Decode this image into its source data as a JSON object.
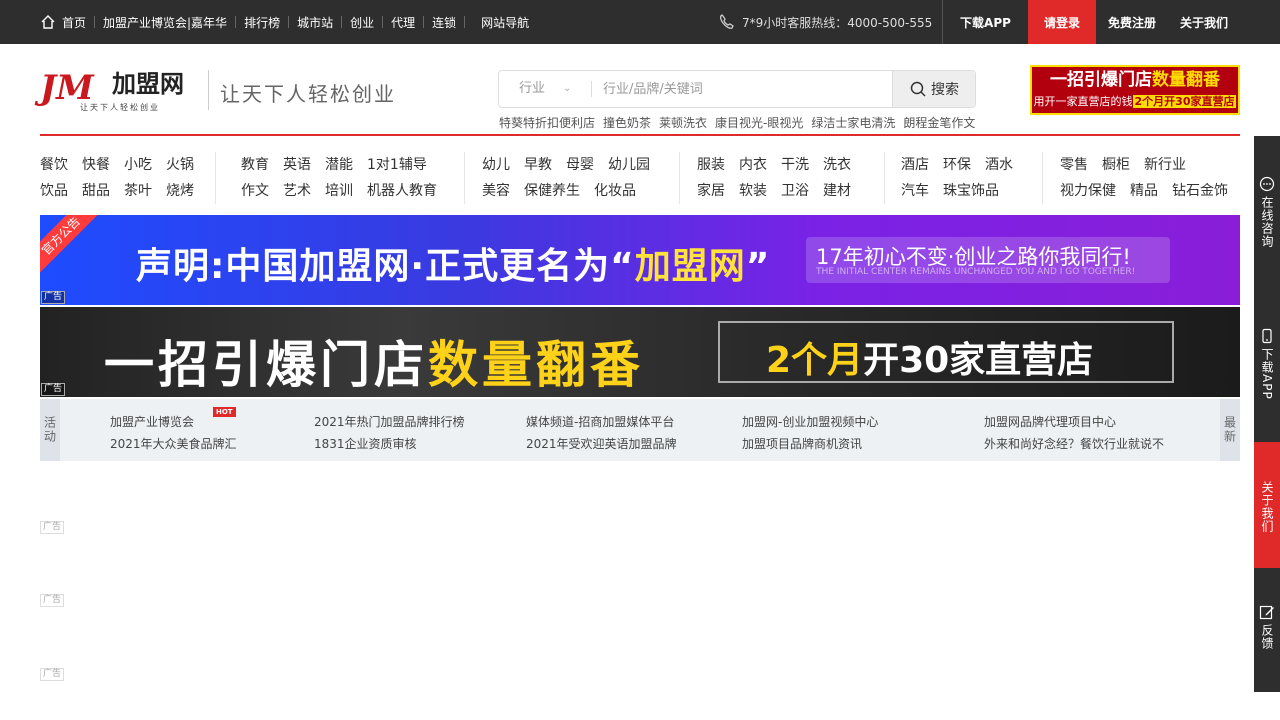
{
  "topbar": {
    "nav": [
      "首页",
      "加盟产业博览会|嘉年华",
      "排行榜",
      "城市站",
      "创业",
      "代理",
      "连锁",
      "网站导航"
    ],
    "hotline": "7*9小时客服热线：4000-500-555",
    "download_app": "下载APP",
    "login": "请登录",
    "register": "免费注册",
    "about": "关于我们"
  },
  "header": {
    "logo_mark": "JM",
    "logo_text": "加盟网",
    "logo_sub": "让天下人轻松创业",
    "slogan": "让天下人轻松创业",
    "search": {
      "category": "行业",
      "placeholder": "行业/品牌/关键词",
      "button": "搜索"
    },
    "hotwords": [
      "特葵特折扣便利店",
      "撞色奶茶",
      "莱顿洗衣",
      "康目视光-眼视光",
      "绿洁士家电清洗",
      "朗程金笔作文"
    ],
    "ad": {
      "line1a": "一招引爆门店",
      "line1b": "数量翻番",
      "line2a": "用开一家直营店的钱",
      "line2b": "2个月开30家直营店"
    }
  },
  "categories": [
    {
      "row1": [
        "餐饮",
        "快餐",
        "小吃",
        "火锅"
      ],
      "row2": [
        "饮品",
        "甜品",
        "茶叶",
        "烧烤"
      ]
    },
    {
      "row1": [
        "教育",
        "英语",
        "潜能",
        "1对1辅导"
      ],
      "row2": [
        "作文",
        "艺术",
        "培训",
        "机器人教育"
      ]
    },
    {
      "row1": [
        "幼儿",
        "早教",
        "母婴",
        "幼儿园"
      ],
      "row2": [
        "美容",
        "保健养生",
        "化妆品"
      ]
    },
    {
      "row1": [
        "服装",
        "内衣",
        "干洗",
        "洗衣"
      ],
      "row2": [
        "家居",
        "软装",
        "卫浴",
        "建材"
      ]
    },
    {
      "row1": [
        "酒店",
        "环保",
        "酒水"
      ],
      "row2": [
        "汽车",
        "珠宝饰品"
      ]
    },
    {
      "row1": [
        "零售",
        "橱柜",
        "新行业"
      ],
      "row2": [
        "视力保健",
        "精品",
        "钻石金饰"
      ]
    }
  ],
  "banner1": {
    "corner": "官方公告",
    "main_a": "声明:中国加盟网·正式更名为“",
    "main_b": "加盟网",
    "main_c": "”",
    "box_title": "17年初心不变·创业之路你我同行!",
    "box_sub": "THE INITIAL CENTER REMAINS UNCHANGED YOU AND I GO TOGETHER!",
    "ad_tag": "广告"
  },
  "banner2": {
    "main_a": "一招引爆门店",
    "main_b": "数量翻番",
    "box_a": "2个月",
    "box_b": "开30家直营店",
    "ad_tag": "广告"
  },
  "activity": {
    "label": "活动",
    "more": "最新",
    "hot_badge": "HOT",
    "columns": [
      [
        "加盟产业博览会",
        "2021年大众美食品牌汇"
      ],
      [
        "2021年热门加盟品牌排行榜",
        "1831企业资质审核"
      ],
      [
        "媒体频道-招商加盟媒体平台",
        "2021年受欢迎英语加盟品牌"
      ],
      [
        "加盟网-创业加盟视频中心",
        "加盟项目品牌商机资讯"
      ],
      [
        "加盟网品牌代理项目中心",
        "外来和尚好念经？餐饮行业就说不"
      ]
    ]
  },
  "ad_placeholders": [
    "广告",
    "广告",
    "广告"
  ],
  "sidebar": {
    "consult": "在线咨询",
    "download": "下载APP",
    "about": "关于我们",
    "feedback": "反馈"
  },
  "colors": {
    "brand_red": "#e02a2a",
    "topbar_bg": "#2e2e2e",
    "highlight_yellow": "#ffd21a"
  }
}
